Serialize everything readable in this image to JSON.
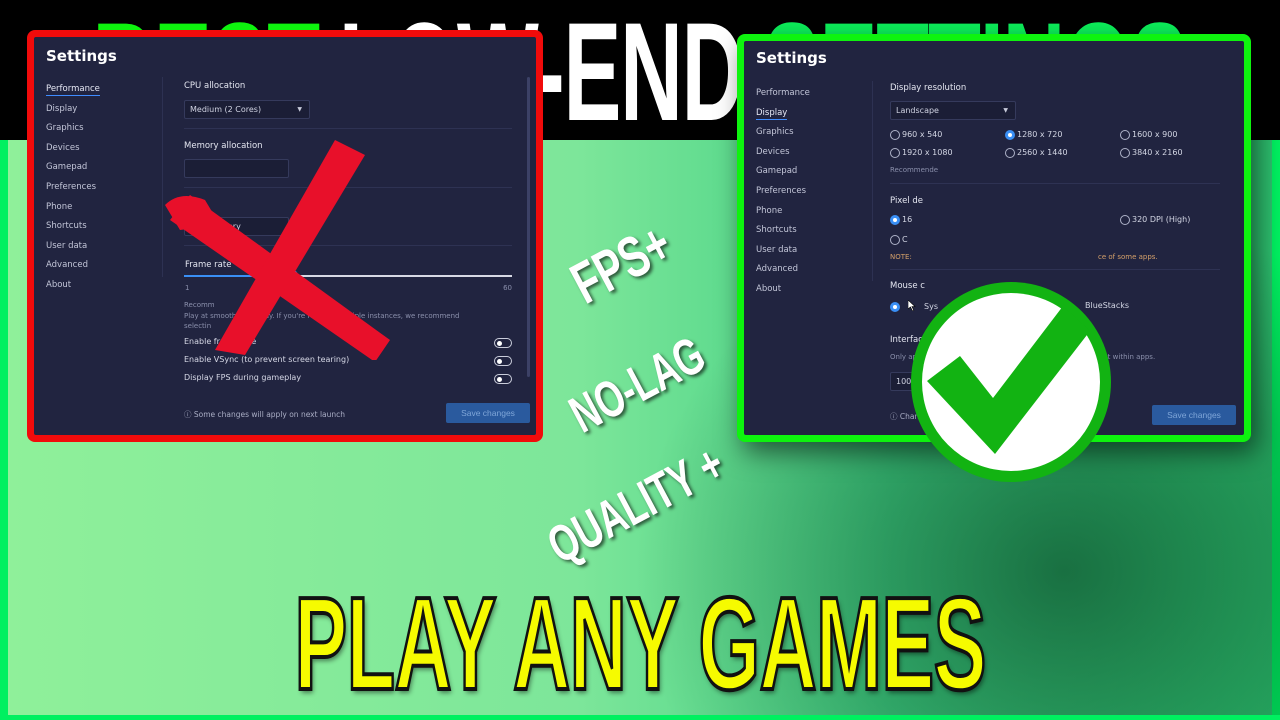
{
  "headline": {
    "words": [
      {
        "text": "BEST",
        "color": "#0ef30e"
      },
      {
        "text": "LOW-END",
        "color": "#ffffff"
      },
      {
        "text": "SETTINGS",
        "color": "#0cf05a"
      }
    ]
  },
  "slogans": {
    "fps": "FPS+",
    "nolag": "NO-LAG",
    "quality": "QUALITY +"
  },
  "bottom_text": "PLAY ANY GAMES",
  "colors": {
    "bad_frame": "#f10b0b",
    "good_frame": "#0ef30e",
    "panel_bg": "#212440",
    "accent": "#3a8ff5",
    "x_mark": "#e8102a",
    "check": "#12b312",
    "bottom_text": "#f6fb00"
  },
  "left_panel": {
    "title": "Settings",
    "nav": [
      "Performance",
      "Display",
      "Graphics",
      "Devices",
      "Gamepad",
      "Preferences",
      "Phone",
      "Shortcuts",
      "User data",
      "Advanced",
      "About"
    ],
    "active_nav": "Performance",
    "cpu_label": "CPU allocation",
    "cpu_value": "Medium (2 Cores)",
    "memory_label": "Memory allocation",
    "perf_label": "P",
    "perf_value": "Low Memory",
    "frame_rate_label": "Frame rate",
    "frame_rate_min": "1",
    "frame_rate_max": "60",
    "frame_rate_fraction": 0.33,
    "recommend_label": "Recomm",
    "recommend_text": "Play at          smooth gameplay. If you're running multiple instances, we recommend",
    "recommend_text2": "selectin",
    "toggles": [
      {
        "label": "Enable      frame rate",
        "on": false
      },
      {
        "label": "Enable VSync (to prevent screen tearing)",
        "on": false
      },
      {
        "label": "Display FPS during gameplay",
        "on": false
      }
    ],
    "footer_note": "ⓘ Some changes will apply on next launch",
    "save_label": "Save changes"
  },
  "right_panel": {
    "title": "Settings",
    "nav": [
      "Performance",
      "Display",
      "Graphics",
      "Devices",
      "Gamepad",
      "Preferences",
      "Phone",
      "Shortcuts",
      "User data",
      "Advanced",
      "About"
    ],
    "active_nav": "Display",
    "resolution_label": "Display resolution",
    "orientation_value": "Landscape",
    "resolutions": [
      {
        "label": "960 x 540",
        "selected": false
      },
      {
        "label": "1280 x 720",
        "selected": true
      },
      {
        "label": "1600 x 900",
        "selected": false
      },
      {
        "label": "1920 x 1080",
        "selected": false
      },
      {
        "label": "2560 x 1440",
        "selected": false
      },
      {
        "label": "3840 x 2160",
        "selected": false
      }
    ],
    "recommended_text": "Recommende",
    "pixel_density_label": "Pixel de",
    "dpi_options": [
      {
        "label": "16",
        "selected": true
      },
      {
        "label": "320 DPI (High)",
        "selected": false
      },
      {
        "label": "C",
        "selected": false
      }
    ],
    "note_label": "NOTE:",
    "note_tail": "ce of some apps.",
    "mouse_label": "Mouse c",
    "mouse_options": [
      {
        "label": "Sys",
        "selected": true
      },
      {
        "label": "BlueStacks",
        "selected": false
      }
    ],
    "scaling_label": "Interface scaling",
    "scaling_help": "Only applies to the size of text and icons in App Player and not within apps.",
    "scaling_value": "100% (Default)",
    "footer_note": "ⓘ Changes will apply on next launch",
    "save_label": "Save changes"
  },
  "icons": {
    "x_mark": "cross-mark",
    "check_mark": "check-mark",
    "dropdown_caret": "▼",
    "cursor": "mouse-pointer"
  }
}
